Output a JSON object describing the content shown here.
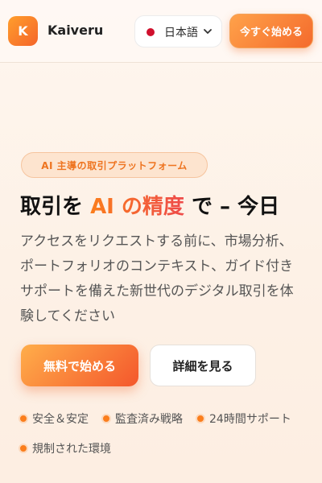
{
  "header": {
    "logo_letter": "K",
    "brand": "Kaiveru",
    "language": "日本語",
    "start_button": "今すぐ始める"
  },
  "hero": {
    "badge": "AI 主導の取引プラットフォーム",
    "headline": {
      "part1": "取引を ",
      "highlight": "AI の精度",
      "part2": " で – 今日"
    },
    "description": "アクセスをリクエストする前に、市場分析、ポートフォリオのコンテキスト、ガイド付きサポートを備えた新世代のデジタル取引を体験してください",
    "primary_cta": "無料で始める",
    "secondary_cta": "詳細を見る"
  },
  "features": [
    "安全＆安定",
    "監査済み戦略",
    "24時間サポート",
    "規制された環境"
  ],
  "colors": {
    "accent": "#f46a2c",
    "accent_light": "#ffa24a",
    "flag": "#d0102d"
  }
}
